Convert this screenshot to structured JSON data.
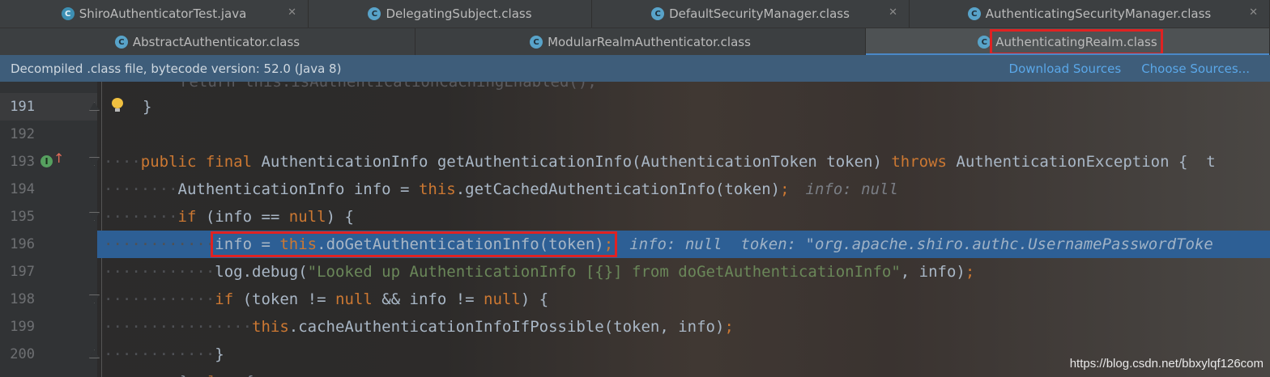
{
  "tabs_row1": [
    {
      "label": "ShiroAuthenticatorTest.java",
      "icon": "java-class-icon",
      "closable": true
    },
    {
      "label": "DelegatingSubject.class",
      "icon": "class-file-icon",
      "closable": false
    },
    {
      "label": "DefaultSecurityManager.class",
      "icon": "class-file-icon",
      "closable": true
    },
    {
      "label": "AuthenticatingSecurityManager.class",
      "icon": "class-file-icon",
      "closable": true
    }
  ],
  "tabs_row2": [
    {
      "label": "AbstractAuthenticator.class",
      "icon": "class-file-icon",
      "closable": false
    },
    {
      "label": "ModularRealmAuthenticator.class",
      "icon": "class-file-icon",
      "closable": false
    },
    {
      "label": "AuthenticatingRealm.class",
      "icon": "class-file-icon",
      "closable": false,
      "active": true
    }
  ],
  "banner": {
    "message": "Decompiled .class file, bytecode version: 52.0 (Java 8)",
    "download_sources": "Download Sources",
    "choose_sources": "Choose Sources..."
  },
  "editor": {
    "lines": [
      {
        "number": "191",
        "text": "}"
      },
      {
        "number": "192",
        "text": ""
      },
      {
        "number": "193",
        "kw1": "public final ",
        "rest1": "AuthenticationInfo getAuthenticationInfo(AuthenticationToken token) ",
        "kw2": "throws ",
        "rest2": "AuthenticationException {  t"
      },
      {
        "number": "194",
        "pre": "AuthenticationInfo info = ",
        "kw": "this",
        "post": ".getCachedAuthenticationInfo(token)",
        "semi": ";",
        "hint": "info: null"
      },
      {
        "number": "195",
        "kw1": "if ",
        "mid": "(info == ",
        "kw2": "null",
        "post": ") {"
      },
      {
        "number": "196",
        "pre": "info = ",
        "kw": "this",
        "post": ".doGetAuthenticationInfo(token)",
        "semi": ";",
        "hint": "info: null  token: \"org.apache.shiro.authc.UsernamePasswordToke"
      },
      {
        "number": "197",
        "pre": "log.debug(",
        "str": "\"Looked up AuthenticationInfo [{}] from doGetAuthenticationInfo\"",
        "post": ", info)",
        "semi": ";"
      },
      {
        "number": "198",
        "kw1": "if ",
        "mid1": "(token != ",
        "kw2": "null",
        "mid2": " && info != ",
        "kw3": "null",
        "post": ") {"
      },
      {
        "number": "199",
        "kw": "this",
        "post": ".cacheAuthenticationInfoIfPossible(token, info)",
        "semi": ";"
      },
      {
        "number": "200",
        "text": "}"
      }
    ]
  },
  "watermark": "https://blog.csdn.net/bbxylqf126com",
  "colors": {
    "keyword": "#cc7832",
    "string": "#6a8759",
    "execution_line": "#2d5f95",
    "highlight_box": "#e02222"
  }
}
